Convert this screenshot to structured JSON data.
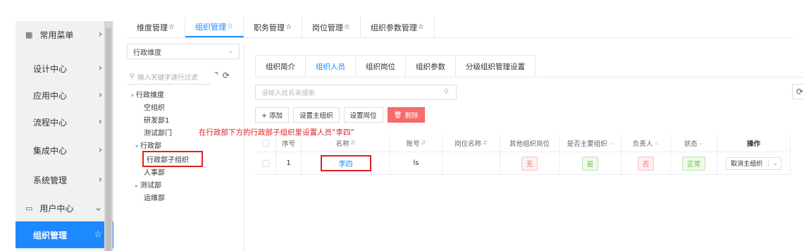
{
  "sidebar": {
    "items": [
      {
        "label": "常用菜单",
        "icon": "grid-icon"
      },
      {
        "label": "设计中心"
      },
      {
        "label": "应用中心"
      },
      {
        "label": "流程中心"
      },
      {
        "label": "集成中心"
      },
      {
        "label": "系统管理"
      },
      {
        "label": "用户中心",
        "icon": "monitor-icon"
      },
      {
        "label": "组织管理"
      }
    ]
  },
  "top_tabs": [
    {
      "label": "维度管理"
    },
    {
      "label": "组织管理"
    },
    {
      "label": "职务管理"
    },
    {
      "label": "岗位管理"
    },
    {
      "label": "组织参数管理"
    }
  ],
  "tree": {
    "dimension_select": "行政维度",
    "search_placeholder": "输入关键字进行过滤",
    "nodes": [
      {
        "label": "行政维度"
      },
      {
        "label": "空组织"
      },
      {
        "label": "研发部1"
      },
      {
        "label": "测试部门"
      },
      {
        "label": "行政部"
      },
      {
        "label": "行政部子组织"
      },
      {
        "label": "人事部"
      },
      {
        "label": "测试部"
      },
      {
        "label": "运维部"
      }
    ]
  },
  "annotation": "在行政部下方的行政部子组织里设置人员“李四”",
  "sub_tabs": [
    {
      "label": "组织简介"
    },
    {
      "label": "组织人员"
    },
    {
      "label": "组织岗位"
    },
    {
      "label": "组织参数"
    },
    {
      "label": "分级组织管理设置"
    }
  ],
  "member_search_placeholder": "请输入姓名来搜索",
  "buttons": {
    "add": "+ 添加",
    "set_main": "设置主组织",
    "set_post": "设置岗位",
    "delete": "删除"
  },
  "table": {
    "headers": [
      "序号",
      "名称",
      "账号",
      "岗位名称",
      "其他组织岗位",
      "是否主要组织",
      "负责人",
      "状态",
      "操作"
    ],
    "rows": [
      {
        "index": "1",
        "name": "李四",
        "account": "ls",
        "post": "",
        "other_post": "无",
        "is_main": "是",
        "leader": "否",
        "status": "正常",
        "action": "取消主组织"
      }
    ]
  },
  "colors": {
    "accent": "#1e88ff",
    "danger": "#f56c6c",
    "success": "#67c23a",
    "annotation": "#e02020"
  }
}
